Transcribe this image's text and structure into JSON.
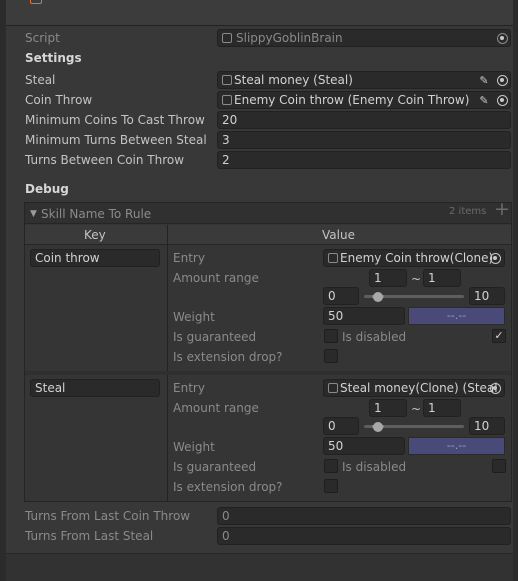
{
  "top": {
    "script_label": "Script",
    "script_value": "SlippyGoblinBrain"
  },
  "settings": {
    "header": "Settings",
    "steal_label": "Steal",
    "steal_value": "Steal money (Steal)",
    "coin_throw_label": "Coin Throw",
    "coin_throw_value": "Enemy Coin throw (Enemy Coin Throw)",
    "min_coins_label": "Minimum Coins To Cast Throw",
    "min_coins_value": "20",
    "min_turns_steal_label": "Minimum Turns Between Steal",
    "min_turns_steal_value": "3",
    "turns_coin_throw_label": "Turns Between Coin Throw",
    "turns_coin_throw_value": "2"
  },
  "debug": {
    "header": "Debug",
    "dict": {
      "title": "Skill Name To Rule",
      "count": "2 items",
      "add_symbol": "+",
      "key_header": "Key",
      "value_header": "Value",
      "entries": [
        {
          "key": "Coin throw",
          "entry_label": "Entry",
          "entry_value": "Enemy Coin throw(Clone)",
          "amount_label": "Amount range",
          "amount_min": "1",
          "tilde": "~",
          "amount_max": "1",
          "range_min": "0",
          "range_max": "10",
          "weight_label": "Weight",
          "weight_value": "50",
          "color_text": "--.--",
          "guaranteed_label": "Is guaranteed",
          "disabled_label": "Is disabled",
          "disabled_checked": true,
          "extension_label": "Is extension drop?"
        },
        {
          "key": "Steal",
          "entry_label": "Entry",
          "entry_value": "Steal money(Clone) (Steal",
          "amount_label": "Amount range",
          "amount_min": "1",
          "tilde": "~",
          "amount_max": "1",
          "range_min": "0",
          "range_max": "10",
          "weight_label": "Weight",
          "weight_value": "50",
          "color_text": "--.--",
          "guaranteed_label": "Is guaranteed",
          "disabled_label": "Is disabled",
          "disabled_checked": false,
          "extension_label": "Is extension drop?"
        }
      ]
    },
    "turns_from_coin_label": "Turns From Last Coin Throw",
    "turns_from_coin_value": "0",
    "turns_from_steal_label": "Turns From Last Steal",
    "turns_from_steal_value": "0"
  },
  "colors": {
    "background": "#383838",
    "field": "#2a2a2a",
    "color_swatch": "#4a4a78"
  }
}
